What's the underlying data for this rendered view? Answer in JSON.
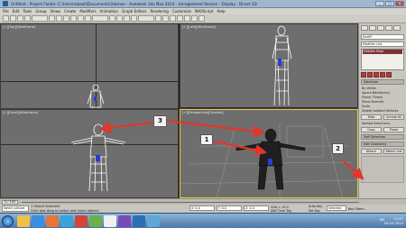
{
  "window": {
    "title": "Untitled - Project Folder: C:\\Users\\abaell\\Documents\\3dsmax - Autodesk 3ds Max 2014 - Unregistered Version - Display : Direct 3D",
    "buttons": [
      "_",
      "□",
      "x"
    ]
  },
  "menu": [
    "File",
    "Edit",
    "Tools",
    "Group",
    "Views",
    "Create",
    "Modifiers",
    "Animation",
    "Graph Editors",
    "Rendering",
    "Customize",
    "MAXScript",
    "Help"
  ],
  "viewports": {
    "top_left": "[+][Top][Wireframe]",
    "top_right": "[+][Left][Wireframe]",
    "bottom_left": "[+][Front][Wireframe]",
    "bottom_right": "[+][Perspective][Shaded]"
  },
  "command_panel": {
    "object_name": "Jindiff",
    "modifier_list": "Modifier List",
    "selected_modifier": "Editable Mesh",
    "selection_rollout": "Selection",
    "params": [
      "By Vertex",
      "Ignore Backfacing",
      "Planar Thresh",
      "Show Normals",
      "Scale",
      "Delete Isolated Vertices",
      "Hide",
      "Unhide All"
    ],
    "named_selections": "Named Selections:",
    "buttons": {
      "copy": "Copy",
      "paste": "Paste"
    },
    "soft_selection": "Soft Selection",
    "edit_geometry": "Edit Geometry",
    "attach": "Attach",
    "attach_list": "Attach List"
  },
  "timeline": {
    "frame": "0 / 100"
  },
  "status": {
    "maxscript": "Select picture",
    "object_selected": "1 Object Selected",
    "hint": "Click and drag to select and move objects",
    "x": "X: 0.0",
    "y": "Y: 0.0",
    "z": "Z: 0.0",
    "grid": "Grid = 10.0",
    "auto_key": "Auto Key",
    "selected": "Selected",
    "set_key": "Set Key",
    "key_filters": "Key Filters...",
    "add_time_tag": "Add Time Tag"
  },
  "taskbar": {
    "tray": "EN",
    "time": "12:47",
    "date": "16.05.2014"
  },
  "callouts": [
    "1",
    "2",
    "3"
  ],
  "colors": {
    "arrow": "#e2352c",
    "active_border": "#e2cd3a",
    "wire": "#ffffff",
    "mesh": "#1f1f1f"
  }
}
